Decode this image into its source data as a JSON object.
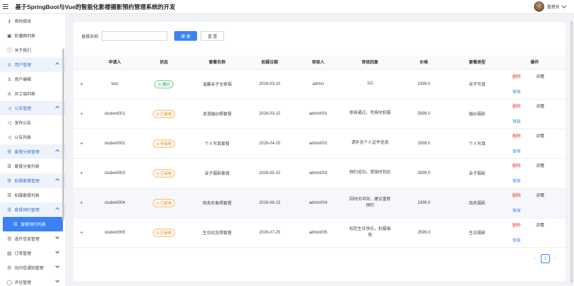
{
  "header": {
    "title": "基于SpringBoot与Vue的智能化影楼摄影预约管理系统的开发",
    "user_name": "管理员"
  },
  "sidebar": {
    "items": [
      {
        "label": "密码修改",
        "icon": "key-icon",
        "kind": "sub"
      },
      {
        "label": "轮播图列表",
        "icon": "image-icon",
        "kind": "sub"
      },
      {
        "label": "关于我们",
        "icon": "info-icon",
        "kind": "sub"
      },
      {
        "label": "用户管理",
        "icon": "users-icon",
        "kind": "group-open"
      },
      {
        "label": "用户编辑",
        "icon": "user-icon",
        "kind": "sub"
      },
      {
        "label": "员工端列表",
        "icon": "user-icon",
        "kind": "sub"
      },
      {
        "label": "公告管理",
        "icon": "megaphone-icon",
        "kind": "group-open"
      },
      {
        "label": "发布公告",
        "icon": "megaphone-icon",
        "kind": "sub"
      },
      {
        "label": "公告列表",
        "icon": "megaphone-icon",
        "kind": "sub"
      },
      {
        "label": "套餐分类管理",
        "icon": "list-icon",
        "kind": "group-open"
      },
      {
        "label": "套餐分类列表",
        "icon": "list-icon",
        "kind": "sub"
      },
      {
        "label": "拍摄套餐管理",
        "icon": "list-icon",
        "kind": "group-open"
      },
      {
        "label": "拍摄套餐列表",
        "icon": "list-icon",
        "kind": "sub"
      },
      {
        "label": "套餐预约管理",
        "icon": "list-icon",
        "kind": "group-open"
      },
      {
        "label": "套餐预约列表",
        "icon": "list-icon",
        "kind": "active"
      },
      {
        "label": "选片信息管理",
        "icon": "list-icon",
        "kind": "group-closed"
      },
      {
        "label": "订单管理",
        "icon": "order-icon",
        "kind": "group-closed"
      },
      {
        "label": "站内信通知管理",
        "icon": "list-icon",
        "kind": "group-closed"
      },
      {
        "label": "评论管理",
        "icon": "comment-icon",
        "kind": "group-closed"
      }
    ]
  },
  "search": {
    "label": "套餐名称:",
    "placeholder": "",
    "value": "",
    "search_button": "搜 索",
    "reset_button": "重 置"
  },
  "table": {
    "columns": [
      "",
      "申请人",
      "状态",
      "套餐名称",
      "拍摄日期",
      "审核人",
      "审核回复",
      "价格",
      "套餐类型",
      "操作"
    ],
    "rows": [
      {
        "applicant": "test",
        "status": "通过",
        "status_type": "approved",
        "package": "温馨亲子全家福",
        "date": "2026-03-10",
        "reviewer": "admin",
        "reply": "111",
        "price": "1999.0",
        "category": "亲子写真",
        "ops": [
          "删除",
          "详情",
          "审核"
        ]
      },
      {
        "applicant": "student001",
        "status": "已审核",
        "status_type": "reviewed",
        "package": "浪漫婚纱照套餐",
        "date": "2026-03-15",
        "reviewer": "admin001",
        "reply": "审核通过，可按时拍摄",
        "price": "5999.0",
        "category": "婚纱摄影",
        "ops": [
          "删除",
          "详情",
          "审核"
        ]
      },
      {
        "applicant": "student002",
        "status": "待审核",
        "status_type": "pending",
        "package": "个人写真套餐",
        "date": "2026-04-20",
        "reviewer": "admin002",
        "reply": "请补充个人证件信息",
        "price": "2999.0",
        "category": "个人写真",
        "ops": [
          "删除",
          "详情",
          "审核"
        ]
      },
      {
        "applicant": "student003",
        "status": "已审核",
        "status_type": "reviewed",
        "package": "亲子摄影套餐",
        "date": "2026-05-10",
        "reviewer": "admin003",
        "reply": "预约成功，请准时到达",
        "price": "3999.0",
        "category": "亲子摄影",
        "ops": [
          "删除",
          "详情",
          "审核"
        ]
      },
      {
        "applicant": "student004",
        "status": "已拒绝",
        "status_type": "rejected",
        "package": "商务形象照套餐",
        "date": "2026-06-15",
        "reviewer": "admin004",
        "reply": "因时间冲突，建议重新预约",
        "price": "1999.0",
        "category": "商务摄影",
        "ops": [
          "删除",
          "详情",
          "审核"
        ]
      },
      {
        "applicant": "student005",
        "status": "已审核",
        "status_type": "reviewed",
        "package": "生日纪念照套餐",
        "date": "2026-07-25",
        "reviewer": "admin005",
        "reply": "祝您生日快乐，拍摄愉快",
        "price": "2599.0",
        "category": "生日摄影",
        "ops": [
          "删除",
          "详情",
          "审核"
        ]
      }
    ]
  },
  "pagination": {
    "current_page": "1"
  }
}
